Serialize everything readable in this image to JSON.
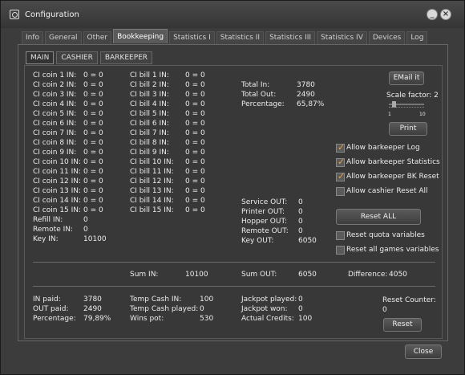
{
  "window": {
    "title": "Configuration"
  },
  "tabs": [
    "Info",
    "General",
    "Other",
    "Bookkeeping",
    "Statistics I",
    "Statistics II",
    "Statistics III",
    "Statistics IV",
    "Devices",
    "Log"
  ],
  "active_tab": "Bookkeeping",
  "subtabs": [
    "MAIN",
    "CASHIER",
    "BARKEEPER"
  ],
  "coins": [
    {
      "label": "CI coin 1 IN:",
      "value": "0 = 0"
    },
    {
      "label": "CI coin 2 IN:",
      "value": "0 = 0"
    },
    {
      "label": "CI coin 3 IN:",
      "value": "0 = 0"
    },
    {
      "label": "CI coin 4 IN:",
      "value": "0 = 0"
    },
    {
      "label": "CI coin 5 IN:",
      "value": "0 = 0"
    },
    {
      "label": "CI coin 6 IN:",
      "value": "0 = 0"
    },
    {
      "label": "CI coin 7 IN:",
      "value": "0 = 0"
    },
    {
      "label": "CI coin 8 IN:",
      "value": "0 = 0"
    },
    {
      "label": "CI coin 9 IN:",
      "value": "0 = 0"
    },
    {
      "label": "CI coin 10 IN:",
      "value": "0 = 0"
    },
    {
      "label": "CI coin 11 IN:",
      "value": "0 = 0"
    },
    {
      "label": "CI coin 12 IN:",
      "value": "0 = 0"
    },
    {
      "label": "CI coin 13 IN:",
      "value": "0 = 0"
    },
    {
      "label": "CI coin 14 IN:",
      "value": "0 = 0"
    },
    {
      "label": "CI coin 15 IN:",
      "value": "0 = 0"
    },
    {
      "label": "Refill IN:",
      "value": "0"
    },
    {
      "label": "Remote IN:",
      "value": "0"
    },
    {
      "label": "Key IN:",
      "value": "10100"
    }
  ],
  "bills": [
    {
      "label": "CI bill 1 IN:",
      "value": "0 = 0"
    },
    {
      "label": "CI bill 2 IN:",
      "value": "0 = 0"
    },
    {
      "label": "CI bill 3 IN:",
      "value": "0 = 0"
    },
    {
      "label": "CI bill 4 IN:",
      "value": "0 = 0"
    },
    {
      "label": "CI bill 5 IN:",
      "value": "0 = 0"
    },
    {
      "label": "CI bill 6 IN:",
      "value": "0 = 0"
    },
    {
      "label": "CI bill 7 IN:",
      "value": "0 = 0"
    },
    {
      "label": "CI bill 8 IN:",
      "value": "0 = 0"
    },
    {
      "label": "CI bill 9 IN:",
      "value": "0 = 0"
    },
    {
      "label": "CI bill 10 IN:",
      "value": "0 = 0"
    },
    {
      "label": "CI bill 11 IN:",
      "value": "0 = 0"
    },
    {
      "label": "CI bill 12 IN:",
      "value": "0 = 0"
    },
    {
      "label": "CI bill 13 IN:",
      "value": "0 = 0"
    },
    {
      "label": "CI bill 14 IN:",
      "value": "0 = 0"
    },
    {
      "label": "CI bill 15 IN:",
      "value": "0 = 0"
    }
  ],
  "totals": [
    {
      "label": "Total In:",
      "value": "3780"
    },
    {
      "label": "Total Out:",
      "value": "2490"
    },
    {
      "label": "Percentage:",
      "value": "65,87%"
    }
  ],
  "outs": [
    {
      "label": "Service OUT:",
      "value": "0"
    },
    {
      "label": "Printer OUT:",
      "value": "0"
    },
    {
      "label": "Hopper OUT:",
      "value": "0"
    },
    {
      "label": "Remote OUT:",
      "value": "0"
    },
    {
      "label": "Key OUT:",
      "value": "6050"
    }
  ],
  "right": {
    "email_label": "EMail it",
    "scale_label": "Scale factor: 2",
    "scale_min": "1",
    "scale_max": "10",
    "scale_value": 2,
    "print_label": "Print",
    "reset_all_label": "Reset ALL"
  },
  "checkboxes": [
    {
      "label": "Allow barkeeper Log",
      "checked": true
    },
    {
      "label": "Allow barkeeper Statistics",
      "checked": true
    },
    {
      "label": "Allow barkeeper BK Reset",
      "checked": true
    },
    {
      "label": "Allow cashier Reset All",
      "checked": false
    }
  ],
  "reset_checkboxes": [
    {
      "label": "Reset quota variables",
      "checked": false
    },
    {
      "label": "Reset all games variables",
      "checked": false
    }
  ],
  "sums": {
    "sum_in_label": "Sum IN:",
    "sum_in": "10100",
    "sum_out_label": "Sum OUT:",
    "sum_out": "6050",
    "difference_label": "Difference:",
    "difference": "4050"
  },
  "bottom_left": [
    {
      "label": "IN paid:",
      "value": "3780"
    },
    {
      "label": "OUT paid:",
      "value": "2490"
    },
    {
      "label": "Percentage:",
      "value": "79,89%"
    }
  ],
  "bottom_mid": [
    {
      "label": "Temp Cash IN:",
      "value": "100"
    },
    {
      "label": "Temp Cash played:",
      "value": "0"
    },
    {
      "label": "Wins pot:",
      "value": "530"
    }
  ],
  "bottom_right": [
    {
      "label": "Jackpot played:",
      "value": "0"
    },
    {
      "label": "Jackpot won:",
      "value": "0"
    },
    {
      "label": "Actual Credits:",
      "value": "100"
    }
  ],
  "reset_counter": {
    "label": "Reset Counter:",
    "value": "0",
    "button": "Reset"
  },
  "close_label": "Close"
}
